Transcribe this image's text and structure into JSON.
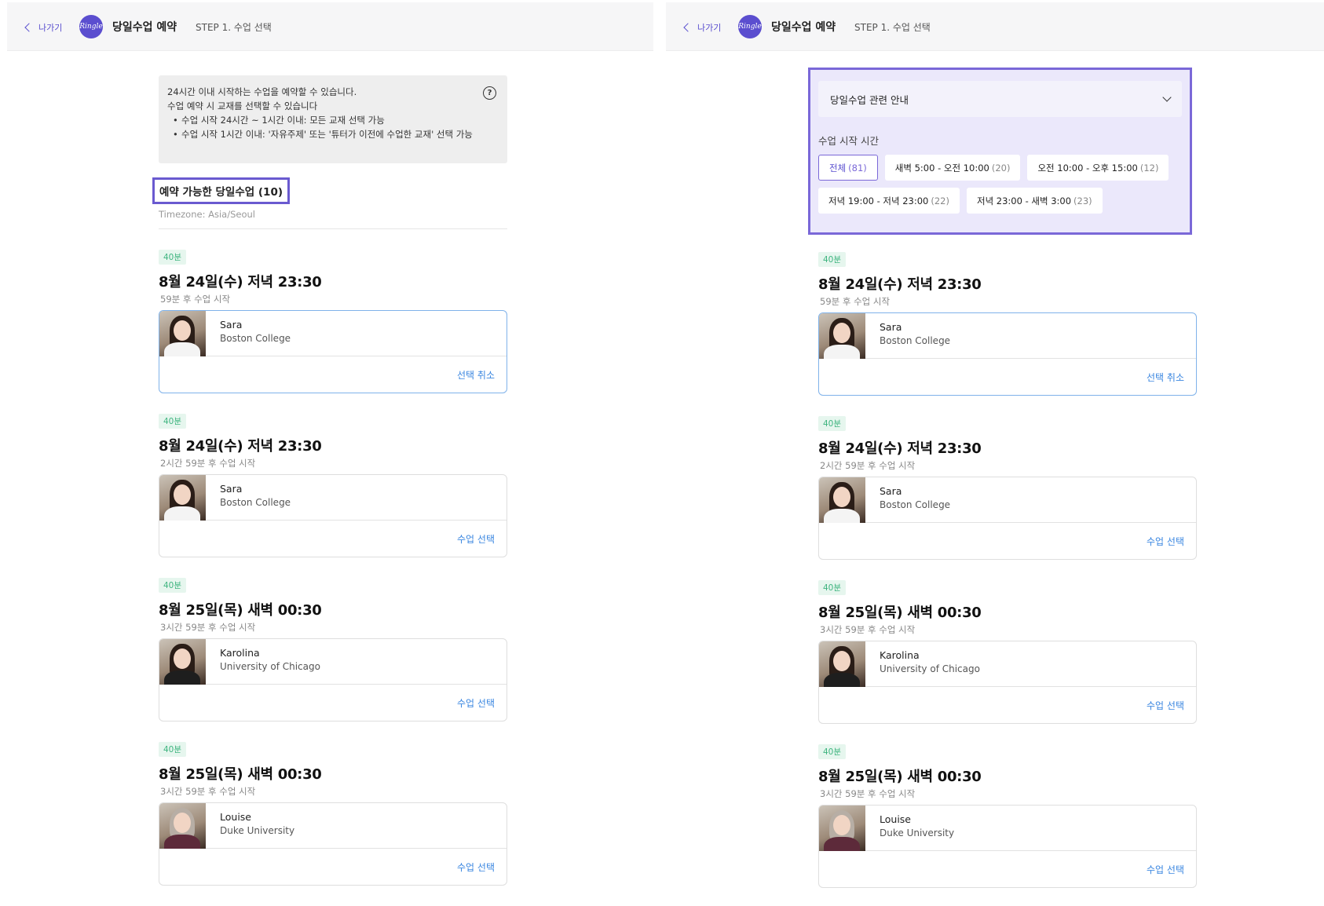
{
  "header": {
    "back_label": "나가기",
    "logo_text": "Ringle",
    "title": "당일수업 예약",
    "step": "STEP 1. 수업 선택"
  },
  "notice": {
    "line1": "24시간 이내 시작하는 수업을 예약할 수 있습니다.",
    "line2": "수업 예약 시 교재를 선택할 수 있습니다",
    "bullets": [
      "수업 시작 24시간 ~ 1시간 이내: 모든 교재 선택 가능",
      "수업 시작 1시간 이내: '자유주제' 또는 '튜터가 이전에 수업한 교재' 선택 가능"
    ],
    "help_icon": "?"
  },
  "available": {
    "title": "예약 가능한 당일수업 (10)",
    "timezone": "Timezone: Asia/Seoul"
  },
  "filter": {
    "accordion_label": "당일수업 관련 안내",
    "time_label": "수업 시작 시간",
    "chips": [
      {
        "label": "전체",
        "count": "(81)"
      },
      {
        "label": "새벽 5:00 - 오전 10:00",
        "count": "(20)"
      },
      {
        "label": "오전 10:00 - 오후 15:00",
        "count": "(12)"
      },
      {
        "label": "저녁 19:00 - 저녁 23:00",
        "count": "(22)"
      },
      {
        "label": "저녁 23:00 - 새벽 3:00",
        "count": "(23)"
      }
    ]
  },
  "lessons": [
    {
      "duration": "40분",
      "time": "8월 24일(수) 저녁 23:30",
      "starts": "59분 후 수업 시작",
      "tutor": "Sara",
      "school": "Boston College",
      "action": "선택 취소"
    },
    {
      "duration": "40분",
      "time": "8월 24일(수) 저녁 23:30",
      "starts": "2시간 59분 후 수업 시작",
      "tutor": "Sara",
      "school": "Boston College",
      "action": "수업 선택"
    },
    {
      "duration": "40분",
      "time": "8월 25일(목) 새벽 00:30",
      "starts": "3시간 59분 후 수업 시작",
      "tutor": "Karolina",
      "school": "University of Chicago",
      "action": "수업 선택"
    },
    {
      "duration": "40분",
      "time": "8월 25일(목) 새벽 00:30",
      "starts": "3시간 59분 후 수업 시작",
      "tutor": "Louise",
      "school": "Duke University",
      "action": "수업 선택"
    }
  ]
}
